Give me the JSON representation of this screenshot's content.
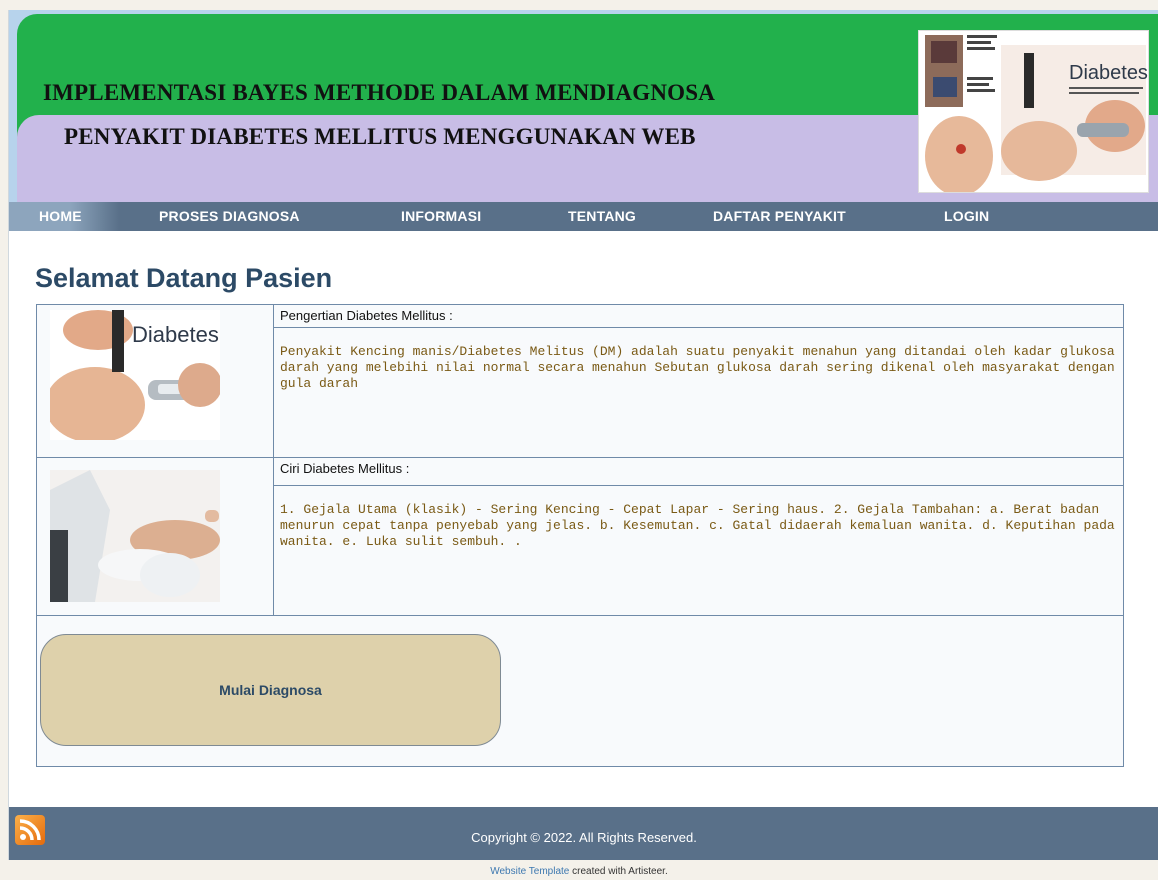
{
  "header": {
    "title_line1": "IMPLEMENTASI BAYES METHODE DALAM MENDIAGNOSA",
    "title_line2": "PENYAKIT DIABETES MELLITUS MENGGUNAKAN WEB",
    "banner_image_label": "Diabetes"
  },
  "nav": {
    "items": [
      "HOME",
      "PROSES DIAGNOSA",
      "INFORMASI",
      "TENTANG",
      "DAFTAR PENYAKIT",
      "LOGIN"
    ]
  },
  "main": {
    "heading": "Selamat Datang Pasien",
    "sections": [
      {
        "image_label": "Diabetes",
        "title": "Pengertian Diabetes Mellitus :",
        "text": "Penyakit Kencing manis/Diabetes Melitus (DM) adalah suatu penyakit menahun yang ditandai oleh kadar glukosa darah yang melebihi nilai normal secara menahun Sebutan glukosa darah sering dikenal oleh masyarakat dengan gula darah"
      },
      {
        "title": "Ciri Diabetes Mellitus :",
        "text": "1. Gejala Utama (klasik) - Sering Kencing - Cepat Lapar - Sering haus. 2. Gejala Tambahan: a. Berat badan menurun cepat tanpa penyebab yang jelas. b. Kesemutan. c. Gatal didaerah kemaluan wanita. d. Keputihan pada wanita. e. Luka sulit sembuh. ."
      }
    ],
    "button_label": "Mulai Diagnosa"
  },
  "footer": {
    "copyright": "Copyright © 2022. All Rights Reserved.",
    "credit_link": "Website Template",
    "credit_text": " created with Artisteer."
  },
  "colors": {
    "header_green": "#22b14c",
    "header_lavender": "#c8bde6",
    "nav_bg": "#597089",
    "heading": "#2c4a66",
    "body_text": "#7a5a15",
    "button_bg": "#ded1ab"
  }
}
